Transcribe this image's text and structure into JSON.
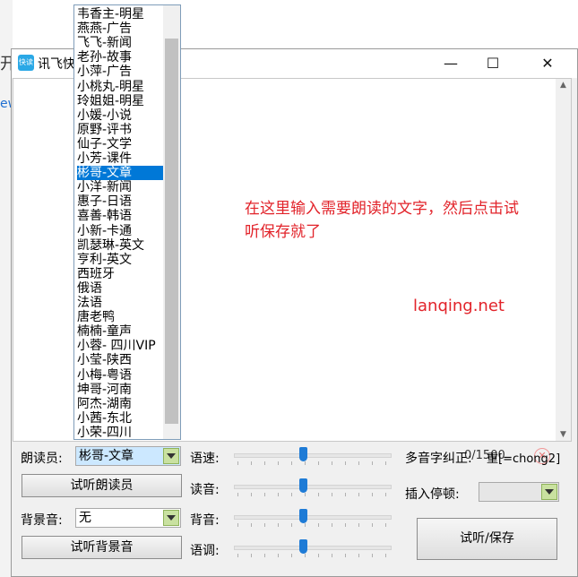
{
  "background": {
    "t1": "开",
    "t2": "ew"
  },
  "window": {
    "title": "讯飞快",
    "icon_text": "快读",
    "minimize": "—",
    "maximize": "☐",
    "close": "✕"
  },
  "editor": {
    "hint": "在这里输入需要朗读的文字，然后点击试听保存就了",
    "site": "lanqing.net",
    "char_count": "0/1500",
    "clear": "✕"
  },
  "controls": {
    "narrator_label": "朗读员:",
    "narrator_value": "彬哥-文章",
    "audition_narrator": "试听朗读员",
    "bgm_label": "背景音:",
    "bgm_value": "无",
    "audition_bgm": "试听背景音",
    "speed_label": "语速:",
    "volume_label": "读音:",
    "bg_volume_label": "背音:",
    "pitch_label": "语调:",
    "polyphone_label": "多音字纠正:",
    "polyphone_value": "重[=chong2]",
    "pause_label": "插入停顿:",
    "play_save": "试听/保存",
    "sliders": {
      "speed": 0.44,
      "volume": 0.44,
      "bg_volume": 0.44,
      "pitch": 0.44
    }
  },
  "dropdown": {
    "items": [
      "韦香主-明星",
      "燕燕-广告",
      "飞飞-新闻",
      "老孙-故事",
      "小萍-广告",
      "小桃丸-明星",
      "玲姐姐-明星",
      "小媛-小说",
      "原野-评书",
      "仙子-文学",
      "小芳-课件",
      "彬哥-文章",
      "小洋-新闻",
      "惠子-日语",
      "喜善-韩语",
      "小新-卡通",
      "凯瑟琳-英文",
      "亨利-英文",
      "西班牙",
      "俄语",
      "法语",
      "唐老鸭",
      "楠楠-童声",
      "小蓉- 四川VIP",
      "小莹-陕西",
      "小梅-粤语",
      "坤哥-河南",
      "阿杰-湖南",
      "小茜-东北",
      "小荣-四川"
    ],
    "selected_index": 11
  }
}
